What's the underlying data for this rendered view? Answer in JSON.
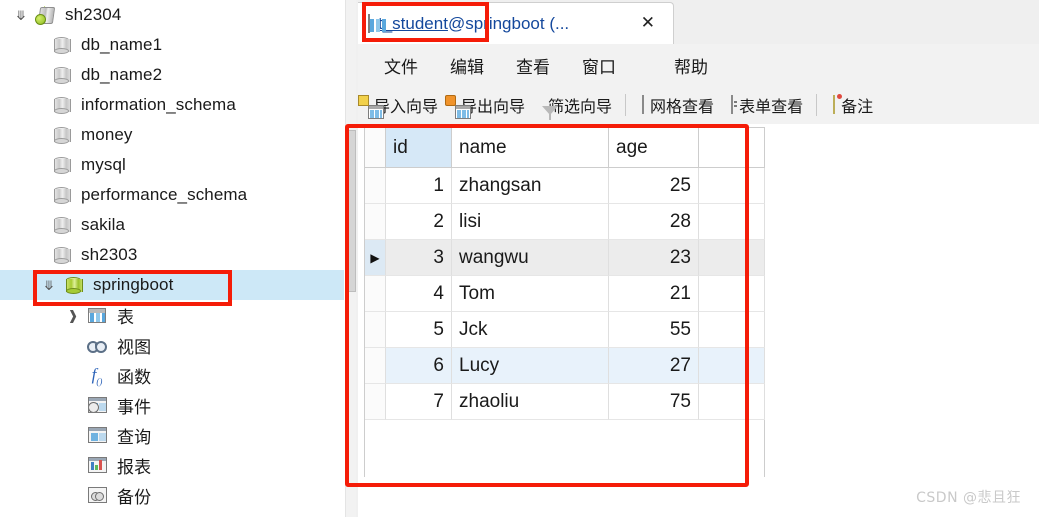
{
  "sidebar": {
    "connection": {
      "label": "sh2304",
      "icon": "connection-icon",
      "expanded_icon": "chevron-down-icon"
    },
    "databases": [
      {
        "label": "db_name1",
        "icon": "database-icon"
      },
      {
        "label": "db_name2",
        "icon": "database-icon"
      },
      {
        "label": "information_schema",
        "icon": "database-icon"
      },
      {
        "label": "money",
        "icon": "database-icon"
      },
      {
        "label": "mysql",
        "icon": "database-icon"
      },
      {
        "label": "performance_schema",
        "icon": "database-icon"
      },
      {
        "label": "sakila",
        "icon": "database-icon"
      },
      {
        "label": "sh2303",
        "icon": "database-icon"
      }
    ],
    "selected_database": {
      "label": "springboot",
      "icon": "database-icon-green",
      "expanded_icon": "chevron-down-icon",
      "selected": true,
      "highlighted": true
    },
    "db_children": [
      {
        "label": "表",
        "icon": "table-icon",
        "twisty": "chevron-right-icon"
      },
      {
        "label": "视图",
        "icon": "view-glasses-icon",
        "twisty": ""
      },
      {
        "label": "函数",
        "icon": "function-fx-icon",
        "twisty": ""
      },
      {
        "label": "事件",
        "icon": "event-icon",
        "twisty": ""
      },
      {
        "label": "查询",
        "icon": "query-icon",
        "twisty": ""
      },
      {
        "label": "报表",
        "icon": "report-icon",
        "twisty": ""
      },
      {
        "label": "备份",
        "icon": "backup-icon",
        "twisty": ""
      }
    ]
  },
  "tab": {
    "icon": "table-icon",
    "name": "t_student",
    "suffix": "@springboot (...",
    "close_icon": "close-icon",
    "highlighted": true
  },
  "menu": {
    "items": [
      "文件",
      "编辑",
      "查看",
      "窗口",
      "帮助"
    ]
  },
  "toolbar": {
    "items": [
      {
        "label": "导入向导",
        "icon": "import-wizard-icon"
      },
      {
        "label": "导出向导",
        "icon": "export-wizard-icon"
      },
      {
        "label": "筛选向导",
        "icon": "filter-icon"
      },
      {
        "label": "网格查看",
        "icon": "grid-view-icon"
      },
      {
        "label": "表单查看",
        "icon": "form-view-icon"
      },
      {
        "label": "备注",
        "icon": "note-icon"
      }
    ]
  },
  "grid": {
    "columns": [
      "id",
      "name",
      "age"
    ],
    "rows": [
      {
        "id": "1",
        "name": "zhangsan",
        "age": "25",
        "marker": "",
        "state": ""
      },
      {
        "id": "2",
        "name": "lisi",
        "age": "28",
        "marker": "",
        "state": ""
      },
      {
        "id": "3",
        "name": "wangwu",
        "age": "23",
        "marker": "▶",
        "state": "current"
      },
      {
        "id": "4",
        "name": "Tom",
        "age": "21",
        "marker": "",
        "state": ""
      },
      {
        "id": "5",
        "name": "Jck",
        "age": "55",
        "marker": "",
        "state": ""
      },
      {
        "id": "6",
        "name": "Lucy",
        "age": "27",
        "marker": "",
        "state": "hl"
      },
      {
        "id": "7",
        "name": "zhaoliu",
        "age": "75",
        "marker": "",
        "state": ""
      }
    ]
  },
  "annotations": {
    "accent_color": "#f51c08",
    "boxes": [
      "tab-name-highlight",
      "springboot-node-highlight",
      "data-grid-highlight"
    ]
  },
  "watermark": {
    "text": "CSDN @悲且狂"
  }
}
